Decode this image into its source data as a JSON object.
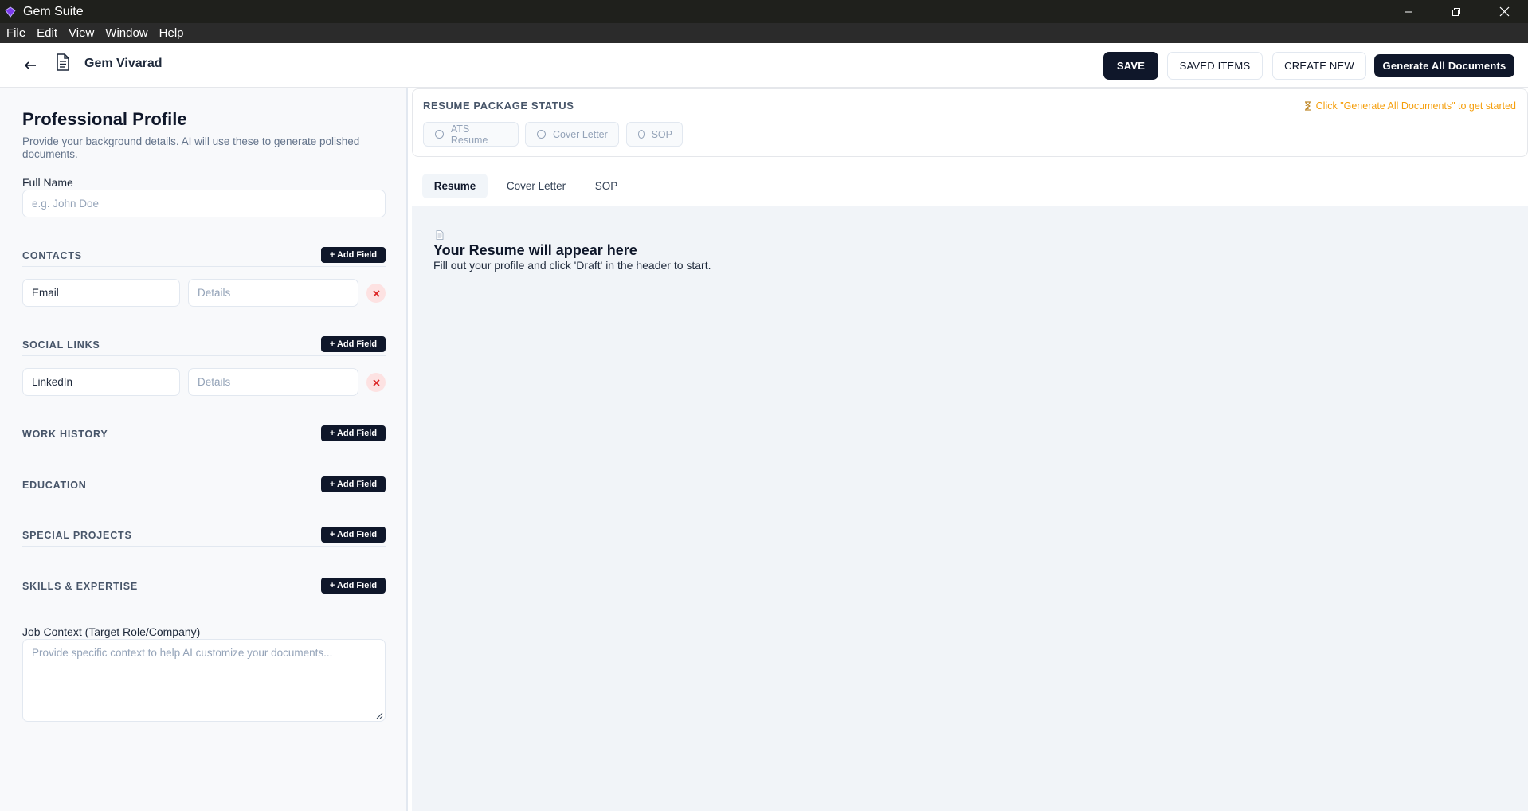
{
  "window": {
    "title": "Gem Suite",
    "controls": [
      "minimize-icon",
      "restore-icon",
      "close-icon"
    ]
  },
  "menu": {
    "items": [
      "File",
      "Edit",
      "View",
      "Window",
      "Help"
    ]
  },
  "header": {
    "back_icon": "arrow-left-icon",
    "doc_icon": "document-icon",
    "doc_name": "Gem Vivarad",
    "save_label": "SAVE",
    "saved_items_label": "SAVED ITEMS",
    "create_new_label": "CREATE NEW",
    "generate_label": "Generate All Documents"
  },
  "profile": {
    "title": "Professional Profile",
    "subtitle": "Provide your background details. AI will use these to generate polished documents.",
    "full_name_label": "Full Name",
    "full_name_placeholder": "e.g. John Doe",
    "add_field_label": "+ Add Field",
    "sections": {
      "contacts": "CONTACTS",
      "social_links": "SOCIAL LINKS",
      "work_history": "WORK HISTORY",
      "education": "EDUCATION",
      "special_projects": "SPECIAL PROJECTS",
      "skills": "SKILLS & EXPERTISE"
    },
    "contacts_rows": [
      {
        "key": "Email",
        "value_placeholder": "Details"
      }
    ],
    "social_rows": [
      {
        "key": "LinkedIn",
        "value_placeholder": "Details"
      }
    ],
    "remove_icon": "close-icon",
    "job_context_label": "Job Context (Target Role/Company)",
    "job_context_placeholder": "Provide specific context to help AI customize your documents..."
  },
  "status": {
    "title": "RESUME PACKAGE STATUS",
    "hint": "Click \"Generate All Documents\" to get started",
    "hint_icon": "hourglass-icon",
    "hint_color": "#f59e0b",
    "items": [
      "ATS Resume",
      "Cover Letter",
      "SOP"
    ]
  },
  "tabs": {
    "items": [
      "Resume",
      "Cover Letter",
      "SOP"
    ],
    "active": "Resume"
  },
  "preview": {
    "icon": "document-icon",
    "title": "Your Resume will appear here",
    "subtitle": "Fill out your profile and click 'Draft' in the header to start."
  },
  "colors": {
    "primary": "#0f172a",
    "accent_warning": "#f59e0b",
    "danger": "#dc2626"
  }
}
